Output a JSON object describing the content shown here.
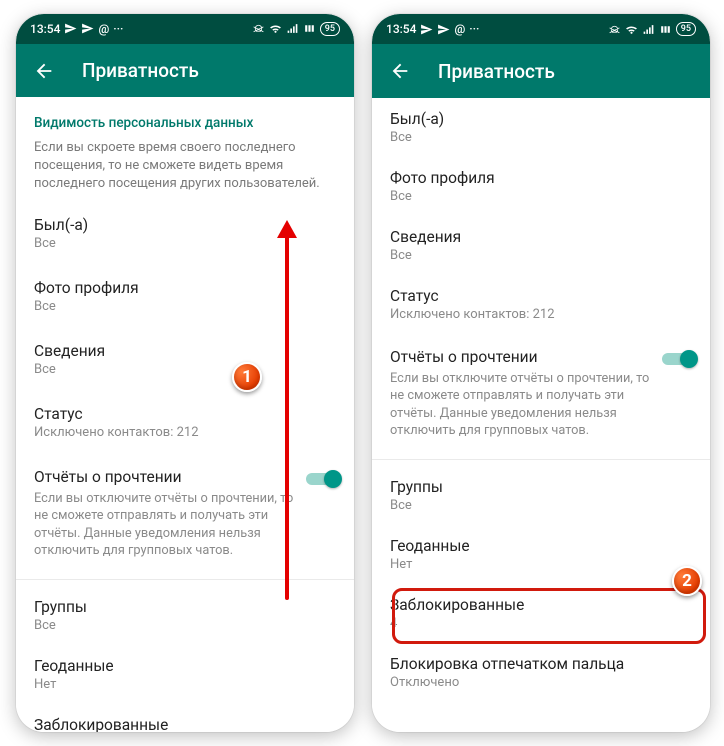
{
  "statusbar": {
    "time": "13:54",
    "battery": "95"
  },
  "screenA": {
    "appbar_title": "Приватность",
    "section_header": "Видимость персональных данных",
    "section_desc": "Если вы скроете время своего последнего посещения, то не сможете видеть время последнего посещения других пользователей.",
    "items": {
      "last_seen": {
        "title": "Был(-а)",
        "sub": "Все"
      },
      "photo": {
        "title": "Фото профиля",
        "sub": "Все"
      },
      "about": {
        "title": "Сведения",
        "sub": "Все"
      },
      "status": {
        "title": "Статус",
        "sub": "Исключено контактов: 212"
      },
      "read_receipts": {
        "title": "Отчёты о прочтении",
        "desc": "Если вы отключите отчёты о прочтении, то не сможете отправлять и получать эти отчёты. Данные уведомления нельзя отключить для групповых чатов."
      },
      "groups": {
        "title": "Группы",
        "sub": "Все"
      },
      "location": {
        "title": "Геоданные",
        "sub": "Нет"
      },
      "blocked": {
        "title": "Заблокированные"
      }
    }
  },
  "screenB": {
    "appbar_title": "Приватность",
    "items": {
      "last_seen": {
        "title": "Был(-а)",
        "sub": "Все"
      },
      "photo": {
        "title": "Фото профиля",
        "sub": "Все"
      },
      "about": {
        "title": "Сведения",
        "sub": "Все"
      },
      "status": {
        "title": "Статус",
        "sub": "Исключено контактов: 212"
      },
      "read_receipts": {
        "title": "Отчёты о прочтении",
        "desc": "Если вы отключите отчёты о прочтении, то не сможете отправлять и получать эти отчёты. Данные уведомления нельзя отключить для групповых чатов."
      },
      "groups": {
        "title": "Группы",
        "sub": "Все"
      },
      "location": {
        "title": "Геоданные",
        "sub": "Нет"
      },
      "blocked": {
        "title": "Заблокированные",
        "sub": "4"
      },
      "fingerprint": {
        "title": "Блокировка отпечатком пальца",
        "sub": "Отключено"
      }
    }
  },
  "annotations": {
    "badge1": "1",
    "badge2": "2"
  }
}
